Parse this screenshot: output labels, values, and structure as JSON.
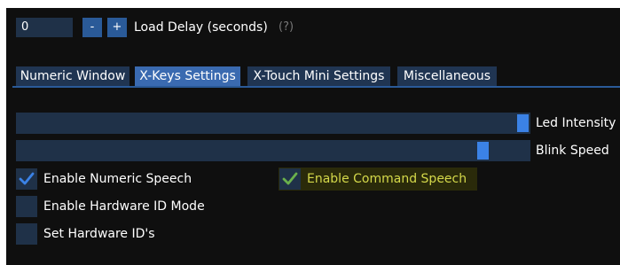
{
  "load_delay": {
    "value": "0",
    "minus_label": "-",
    "plus_label": "+",
    "label": "Load Delay (seconds)",
    "help": "(?)"
  },
  "tabs": [
    {
      "label": "Numeric Window",
      "active": false
    },
    {
      "label": "X-Keys Settings",
      "active": true
    },
    {
      "label": "X-Touch Mini Settings",
      "active": false
    },
    {
      "label": "Miscellaneous",
      "active": false
    }
  ],
  "sliders": [
    {
      "label": "Led Intensity",
      "level": 1.0
    },
    {
      "label": "Blink Speed",
      "level": 0.91
    }
  ],
  "checkboxes": {
    "numeric_speech": {
      "label": "Enable Numeric Speech",
      "checked": true
    },
    "command_speech": {
      "label": "Enable Command Speech",
      "checked": true
    },
    "hardware_id_mode": {
      "label": "Enable Hardware ID Mode",
      "checked": false
    },
    "set_hardware_ids": {
      "label": "Set Hardware ID's",
      "checked": false
    }
  },
  "colors": {
    "accent": "#3b82e6",
    "frame": "#1f3148",
    "highlight_text": "#d4d84a",
    "check_normal": "#3b82e6",
    "check_highlight": "#6ab04c"
  }
}
